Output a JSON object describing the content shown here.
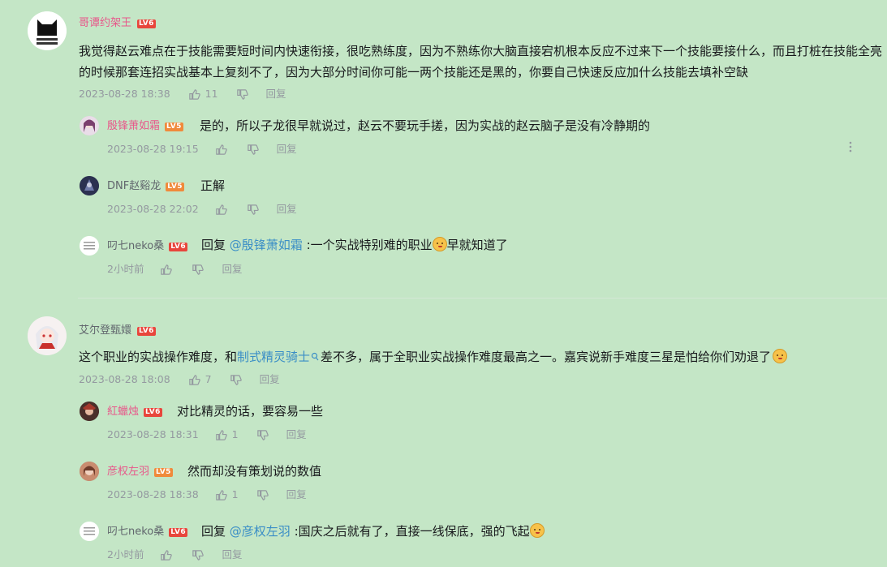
{
  "comments": [
    {
      "user": "哥谭约架王",
      "level": "LV6",
      "text": "我觉得赵云难点在于技能需要短时间内快速衔接，很吃熟练度，因为不熟练你大脑直接宕机根本反应不过来下一个技能要接什么，而且打桩在技能全亮的时候那套连招实战基本上复刻不了，因为大部分时间你可能一两个技能还是黑的，你要自己快速反应加什么技能去填补空缺",
      "time": "2023-08-28 18:38",
      "likes": "11",
      "reply_label": "回复",
      "replies": [
        {
          "user": "殷锋萧如霜",
          "level": "LV5",
          "text": "是的，所以子龙很早就说过，赵云不要玩手搓，因为实战的赵云脑子是没有冷静期的",
          "time": "2023-08-28 19:15",
          "reply_label": "回复"
        },
        {
          "user": "DNF赵谿龙",
          "level": "LV5",
          "text": "正解",
          "time": "2023-08-28 22:02",
          "reply_label": "回复"
        },
        {
          "user": "叼七neko桑",
          "level": "LV6",
          "prefix": "回复 ",
          "mention": "@殷锋萧如霜",
          "text": " :一个实战特别难的职业",
          "text_after": "早就知道了",
          "time": "2小时前",
          "reply_label": "回复"
        }
      ]
    },
    {
      "user": "艾尔登甄嬛",
      "level": "LV6",
      "text_pre": "这个职业的实战操作难度，和",
      "link": "制式精灵骑士",
      "text_post": "差不多，属于全职业实战操作难度最高之一。嘉宾说新手难度三星是怕给你们劝退了",
      "time": "2023-08-28 18:08",
      "likes": "7",
      "reply_label": "回复",
      "replies": [
        {
          "user": "紅蠟烛",
          "level": "LV6",
          "text": "对比精灵的话，要容易一些",
          "time": "2023-08-28 18:31",
          "likes": "1",
          "reply_label": "回复"
        },
        {
          "user": "彦权左羽",
          "level": "LV5",
          "text": "然而却没有策划说的数值",
          "time": "2023-08-28 18:38",
          "likes": "1",
          "reply_label": "回复"
        },
        {
          "user": "叼七neko桑",
          "level": "LV6",
          "prefix": "回复 ",
          "mention": "@彦权左羽",
          "text": " :国庆之后就有了，直接一线保底，强的飞起",
          "time": "2小时前",
          "reply_label": "回复"
        }
      ]
    }
  ],
  "colors": {
    "background": "#c4e6c6",
    "name_pink": "#e8578a",
    "link": "#3a8ec6",
    "level_badge": "#e8463c"
  },
  "icons": [
    "thumb-up-icon",
    "thumb-down-icon",
    "more-icon",
    "search-link-icon"
  ]
}
